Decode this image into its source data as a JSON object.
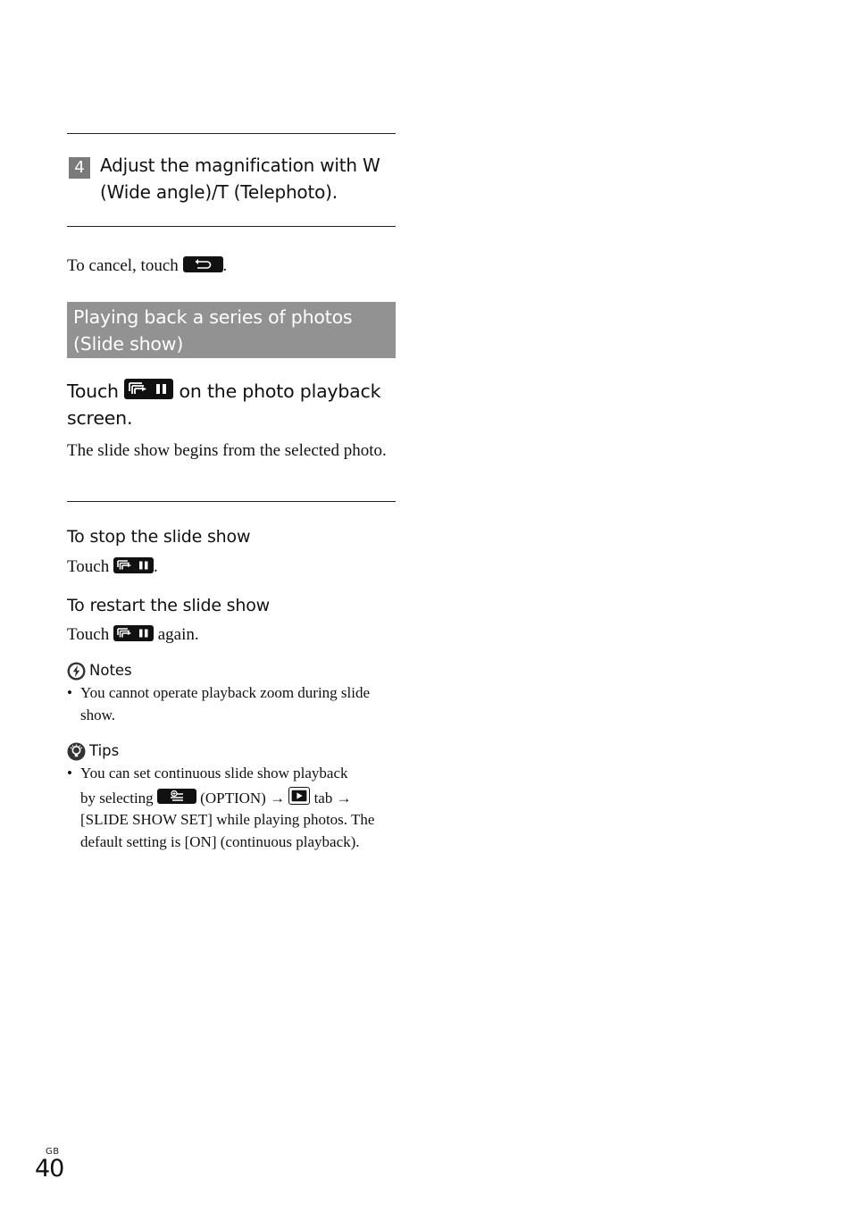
{
  "step": {
    "number": "4",
    "text": "Adjust the magnification with W (Wide angle)/T (Telephoto)."
  },
  "cancel": {
    "prefix": "To cancel, touch",
    "icon": "return-icon",
    "suffix": "."
  },
  "section": {
    "title": "Playing back a series of photos (Slide show)"
  },
  "instruction": {
    "prefix": "Touch",
    "icon": "slideshow-pause-icon",
    "suffix": "on the photo playback screen.",
    "description": "The slide show begins from the selected photo."
  },
  "stop": {
    "heading": "To stop the slide show",
    "prefix": "Touch",
    "icon": "slideshow-pause-icon",
    "suffix": "."
  },
  "restart": {
    "heading": "To restart the slide show",
    "prefix": "Touch",
    "icon": "slideshow-pause-icon",
    "suffix": "again."
  },
  "notes": {
    "heading": "Notes",
    "icon": "notes-lightning-icon",
    "items": [
      "You cannot operate playback zoom during slide show."
    ]
  },
  "tips": {
    "heading": "Tips",
    "icon": "tips-lightbulb-icon",
    "line1": "You can set continuous slide show playback",
    "by_selecting": "by selecting",
    "option_label": "(OPTION)",
    "arrow": "→",
    "tab_label": "tab",
    "rest": "[SLIDE SHOW SET] while playing photos. The default setting is [ON] (continuous playback)."
  },
  "footer": {
    "region": "GB",
    "page_number": "40"
  }
}
